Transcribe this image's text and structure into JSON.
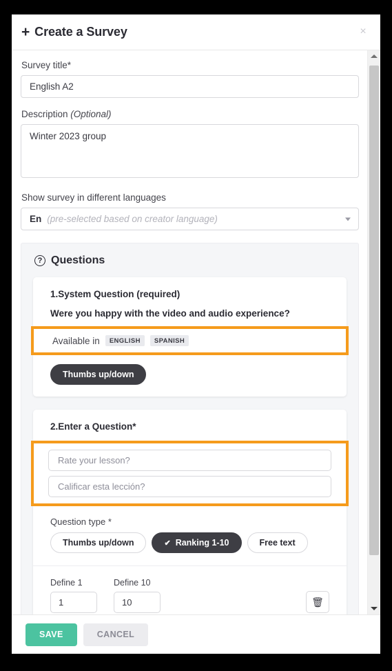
{
  "header": {
    "title": "Create a Survey",
    "plus_icon": "plus-icon",
    "close_icon": "×"
  },
  "form": {
    "title_label": "Survey title*",
    "title_value": "English A2",
    "description_label": "Description ",
    "description_label_optional": "(Optional)",
    "description_value": "Winter 2023 group",
    "language_label": "Show survey in different languages",
    "language_code": "En",
    "language_hint": "(pre-selected based on creator language)"
  },
  "questions": {
    "section_title": "Questions",
    "help_icon": "?",
    "items": [
      {
        "number_label": "1.System Question (required)",
        "text": "Were you happy with the video and audio experience?",
        "available_label": "Available in",
        "badges": [
          "ENGLISH",
          "SPANISH"
        ],
        "type_pill": "Thumbs up/down"
      },
      {
        "number_label": "2.Enter a Question*",
        "input_en": "Rate your lesson?",
        "input_es": "Calificar esta lección?",
        "type_label": "Question type *",
        "types": [
          {
            "label": "Thumbs up/down",
            "selected": false
          },
          {
            "label": "Ranking 1-10",
            "selected": true
          },
          {
            "label": "Free text",
            "selected": false
          }
        ],
        "check_glyph": "✔",
        "define_min_label": "Define 1",
        "define_min_value": "1",
        "define_max_label": "Define 10",
        "define_max_value": "10",
        "delete_icon": "🗑"
      }
    ]
  },
  "footer": {
    "save_label": "SAVE",
    "cancel_label": "CANCEL"
  },
  "colors": {
    "highlight": "#f59b1c",
    "save": "#4cc3a0",
    "pill_selected": "#3e3e44"
  }
}
